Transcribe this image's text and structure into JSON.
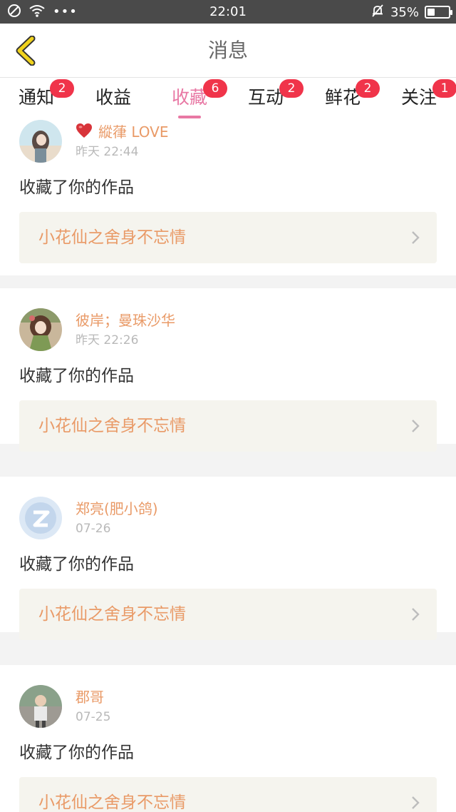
{
  "status_bar": {
    "time": "22:01",
    "battery_text": "35%",
    "battery_level": 0.35
  },
  "header": {
    "title": "消息"
  },
  "tabs": [
    {
      "label": "通知",
      "badge": "2"
    },
    {
      "label": "收益",
      "badge": ""
    },
    {
      "label": "收藏",
      "badge": "6",
      "active": true
    },
    {
      "label": "互动",
      "badge": "2"
    },
    {
      "label": "鲜花",
      "badge": "2"
    },
    {
      "label": "关注",
      "badge": "1"
    }
  ],
  "feed": [
    {
      "user": "縱葎 LOVE",
      "time": "昨天 22:44",
      "action": "收藏了你的作品",
      "work": "小花仙之舍身不忘情",
      "has_heart": true
    },
    {
      "user": "彼岸；曼珠沙华",
      "time": "昨天 22:26",
      "action": "收藏了你的作品",
      "work": "小花仙之舍身不忘情"
    },
    {
      "user": "郑亮(肥小鸽)",
      "time": "07-26",
      "action": "收藏了你的作品",
      "work": "小花仙之舍身不忘情"
    },
    {
      "user": "郡哥",
      "time": "07-25",
      "action": "收藏了你的作品",
      "work": "小花仙之舍身不忘情"
    }
  ],
  "colors": {
    "accent": "#e878a4",
    "name": "#e99a67",
    "badge": "#f0344a",
    "back_arrow": "#f0d21c"
  }
}
